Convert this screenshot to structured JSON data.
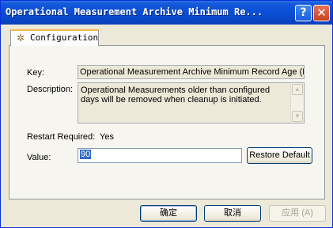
{
  "window": {
    "title": "Operational Measurement Archive Minimum Re...",
    "help_glyph": "?",
    "close_glyph": "✕"
  },
  "tab": {
    "label": "Configuration",
    "icon": "gear-icon"
  },
  "form": {
    "key_label": "Key:",
    "key_value": "Operational Measurement Archive Minimum Record Age (Da",
    "description_label": "Description:",
    "description_value": "Operational Measurements older than configured days will be removed when cleanup is initiated.",
    "restart_label": "Restart Required:",
    "restart_value": "Yes",
    "value_label": "Value:",
    "value_current": "90",
    "restore_default_label": "Restore Default"
  },
  "footer": {
    "ok_label": "确定",
    "cancel_label": "取消",
    "apply_label": "应用",
    "apply_accel": "(A)"
  }
}
